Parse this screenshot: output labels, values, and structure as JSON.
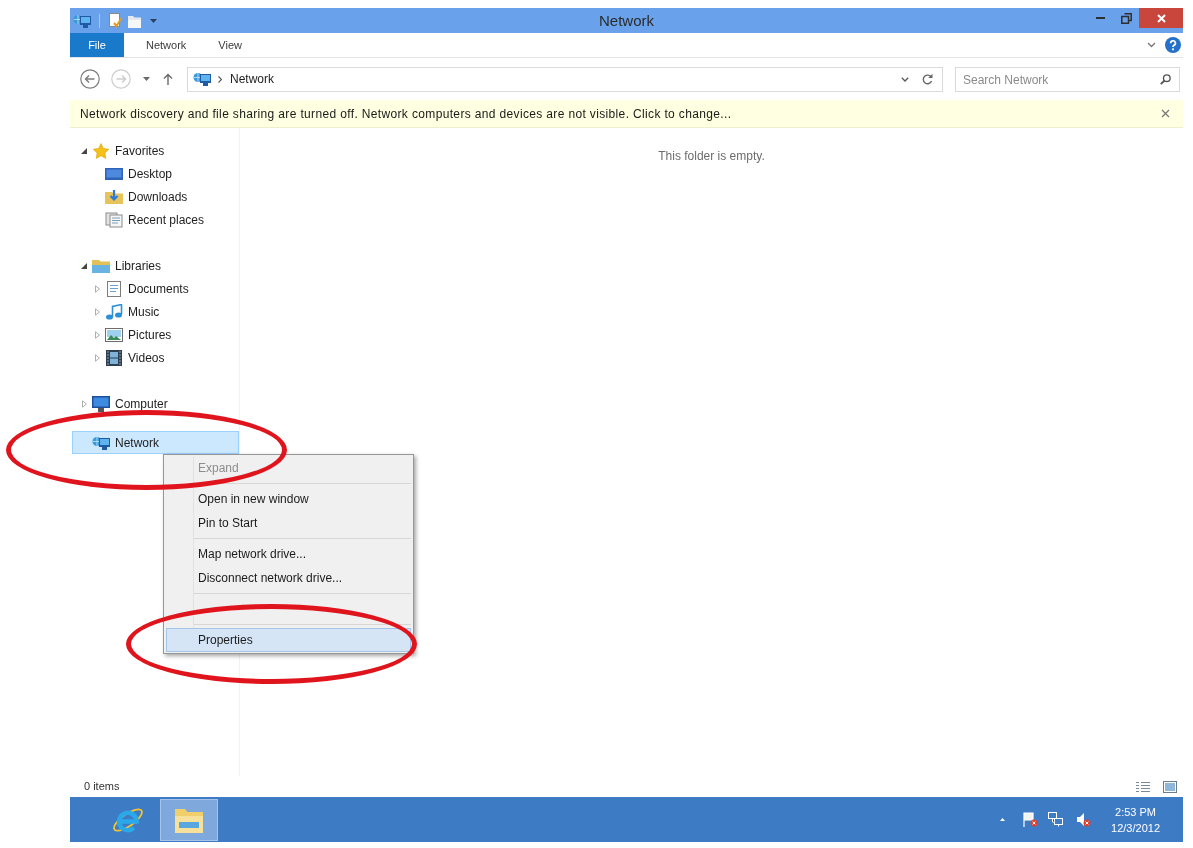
{
  "window": {
    "title": "Network"
  },
  "ribbon": {
    "tabs": [
      {
        "label": "File",
        "kind": "file"
      },
      {
        "label": "Network",
        "kind": "tab"
      },
      {
        "label": "View",
        "kind": "tab"
      }
    ]
  },
  "navigation": {
    "back": {
      "disabled": false
    },
    "forward": {
      "disabled": true
    }
  },
  "address": {
    "path": [
      {
        "label": "Network"
      }
    ]
  },
  "search": {
    "placeholder": "Search Network"
  },
  "info_bar": {
    "text": "Network discovery and file sharing are turned off. Network computers and devices are not visible. Click to change..."
  },
  "nav": [
    {
      "label": "Favorites",
      "kind": "favorites",
      "expanded": true,
      "selected": false,
      "circled": false,
      "children": [
        {
          "label": "Desktop",
          "kind": "desktop",
          "selected": false,
          "circled": false
        },
        {
          "label": "Downloads",
          "kind": "downloads",
          "selected": false,
          "circled": false
        },
        {
          "label": "Recent places",
          "kind": "recent",
          "selected": false,
          "circled": false
        }
      ]
    },
    {
      "label": "Libraries",
      "kind": "libraries",
      "expanded": true,
      "selected": false,
      "circled": false,
      "children": [
        {
          "label": "Documents",
          "kind": "documents",
          "expanded": false,
          "selected": false,
          "circled": false
        },
        {
          "label": "Music",
          "kind": "music",
          "expanded": false,
          "selected": false,
          "circled": false
        },
        {
          "label": "Pictures",
          "kind": "pictures",
          "expanded": false,
          "selected": false,
          "circled": false
        },
        {
          "label": "Videos",
          "kind": "videos",
          "expanded": false,
          "selected": false,
          "circled": false
        }
      ]
    },
    {
      "label": "Computer",
      "kind": "computer",
      "expanded": false,
      "selected": false,
      "circled": false
    },
    {
      "label": "Network",
      "kind": "network",
      "selected": true,
      "circled": true
    }
  ],
  "content": {
    "empty_text": "This folder is empty."
  },
  "context_menu": {
    "items": [
      {
        "kind": "item",
        "label": "Expand",
        "disabled": true,
        "selected": false,
        "circled": false
      },
      {
        "kind": "separator"
      },
      {
        "kind": "item",
        "label": "Open in new window",
        "disabled": false,
        "selected": false,
        "circled": false
      },
      {
        "kind": "item",
        "label": "Pin to Start",
        "disabled": false,
        "selected": false,
        "circled": false
      },
      {
        "kind": "separator"
      },
      {
        "kind": "item",
        "label": "Map network drive...",
        "disabled": false,
        "selected": false,
        "circled": false
      },
      {
        "kind": "item",
        "label": "Disconnect network drive...",
        "disabled": false,
        "selected": false,
        "circled": false
      },
      {
        "kind": "separator"
      },
      {
        "kind": "obscured"
      },
      {
        "kind": "separator"
      },
      {
        "kind": "item",
        "label": "Properties",
        "disabled": false,
        "selected": true,
        "circled": true
      }
    ]
  },
  "status_bar": {
    "text": "0 items"
  },
  "taskbar": {
    "apps": [
      {
        "kind": "browser",
        "selected": false
      },
      {
        "kind": "explorer",
        "selected": true
      }
    ],
    "clock": {
      "time": "2:53 PM",
      "date": "12/3/2012"
    }
  }
}
